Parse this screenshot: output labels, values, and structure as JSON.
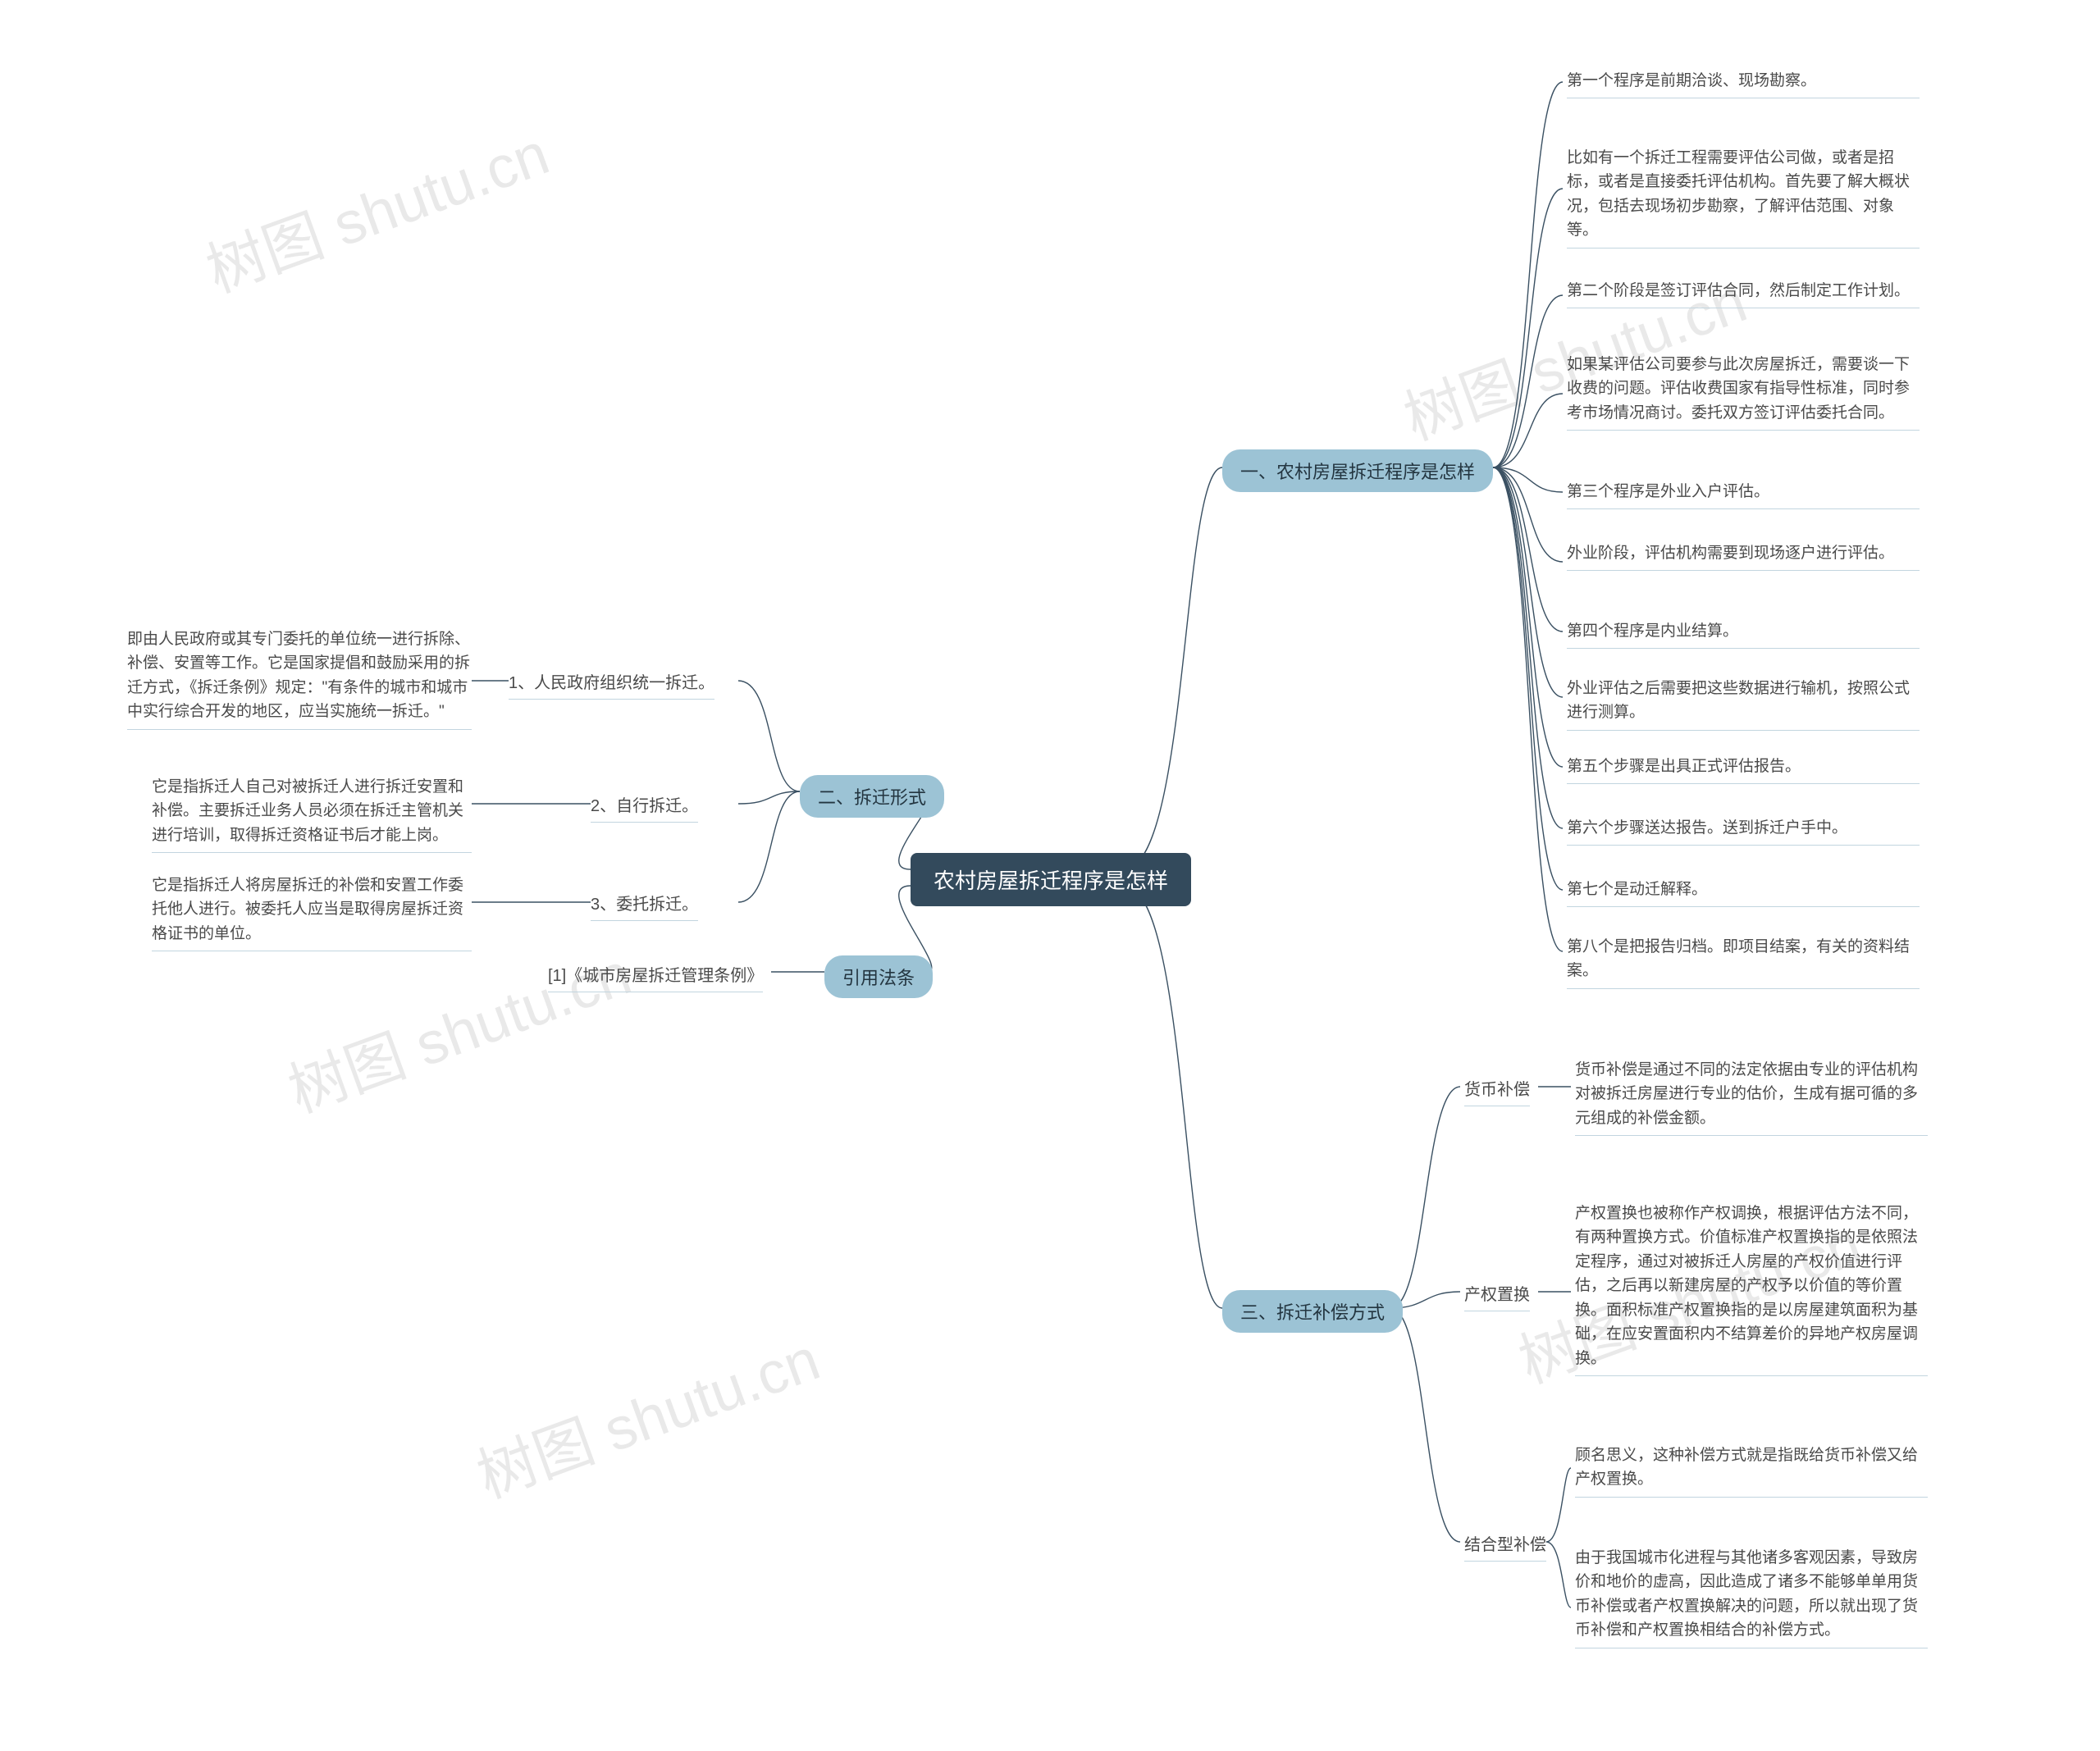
{
  "watermark": "树图 shutu.cn",
  "root": {
    "label": "农村房屋拆迁程序是怎样"
  },
  "branches": {
    "b1": {
      "label": "一、农村房屋拆迁程序是怎样"
    },
    "b2": {
      "label": "二、拆迁形式"
    },
    "b3": {
      "label": "三、拆迁补偿方式"
    },
    "b4": {
      "label": "引用法条"
    }
  },
  "b1_items": [
    "第一个程序是前期洽谈、现场勘察。",
    "比如有一个拆迁工程需要评估公司做，或者是招标，或者是直接委托评估机构。首先要了解大概状况，包括去现场初步勘察，了解评估范围、对象等。",
    "第二个阶段是签订评估合同，然后制定工作计划。",
    "如果某评估公司要参与此次房屋拆迁，需要谈一下收费的问题。评估收费国家有指导性标准，同时参考市场情况商讨。委托双方签订评估委托合同。",
    "第三个程序是外业入户评估。",
    "外业阶段，评估机构需要到现场逐户进行评估。",
    "第四个程序是内业结算。",
    "外业评估之后需要把这些数据进行输机，按照公式进行测算。",
    "第五个步骤是出具正式评估报告。",
    "第六个步骤送达报告。送到拆迁户手中。",
    "第七个是动迁解释。",
    "第八个是把报告归档。即项目结案，有关的资料结案。"
  ],
  "b2_items": [
    {
      "title": "1、人民政府组织统一拆迁。",
      "desc": "即由人民政府或其专门委托的单位统一进行拆除、补偿、安置等工作。它是国家提倡和鼓励采用的拆迁方式，《拆迁条例》规定：\"有条件的城市和城市中实行综合开发的地区，应当实施统一拆迁。\""
    },
    {
      "title": "2、自行拆迁。",
      "desc": "它是指拆迁人自己对被拆迁人进行拆迁安置和补偿。主要拆迁业务人员必须在拆迁主管机关进行培训，取得拆迁资格证书后才能上岗。"
    },
    {
      "title": "3、委托拆迁。",
      "desc": "它是指拆迁人将房屋拆迁的补偿和安置工作委托他人进行。被委托人应当是取得房屋拆迁资格证书的单位。"
    }
  ],
  "b3_items": [
    {
      "title": "货币补偿",
      "desc": [
        "货币补偿是通过不同的法定依据由专业的评估机构对被拆迁房屋进行专业的估价，生成有据可循的多元组成的补偿金额。"
      ]
    },
    {
      "title": "产权置换",
      "desc": [
        "产权置换也被称作产权调换，根据评估方法不同，有两种置换方式。价值标准产权置换指的是依照法定程序，通过对被拆迁人房屋的产权价值进行评估，之后再以新建房屋的产权予以价值的等价置换。面积标准产权置换指的是以房屋建筑面积为基础，在应安置面积内不结算差价的异地产权房屋调换。"
      ]
    },
    {
      "title": "结合型补偿",
      "desc": [
        "顾名思义，这种补偿方式就是指既给货币补偿又给产权置换。",
        "由于我国城市化进程与其他诸多客观因素，导致房价和地价的虚高，因此造成了诸多不能够单单用货币补偿或者产权置换解决的问题，所以就出现了货币补偿和产权置换相结合的补偿方式。"
      ]
    }
  ],
  "b4_items": [
    "[1]《城市房屋拆迁管理条例》"
  ]
}
